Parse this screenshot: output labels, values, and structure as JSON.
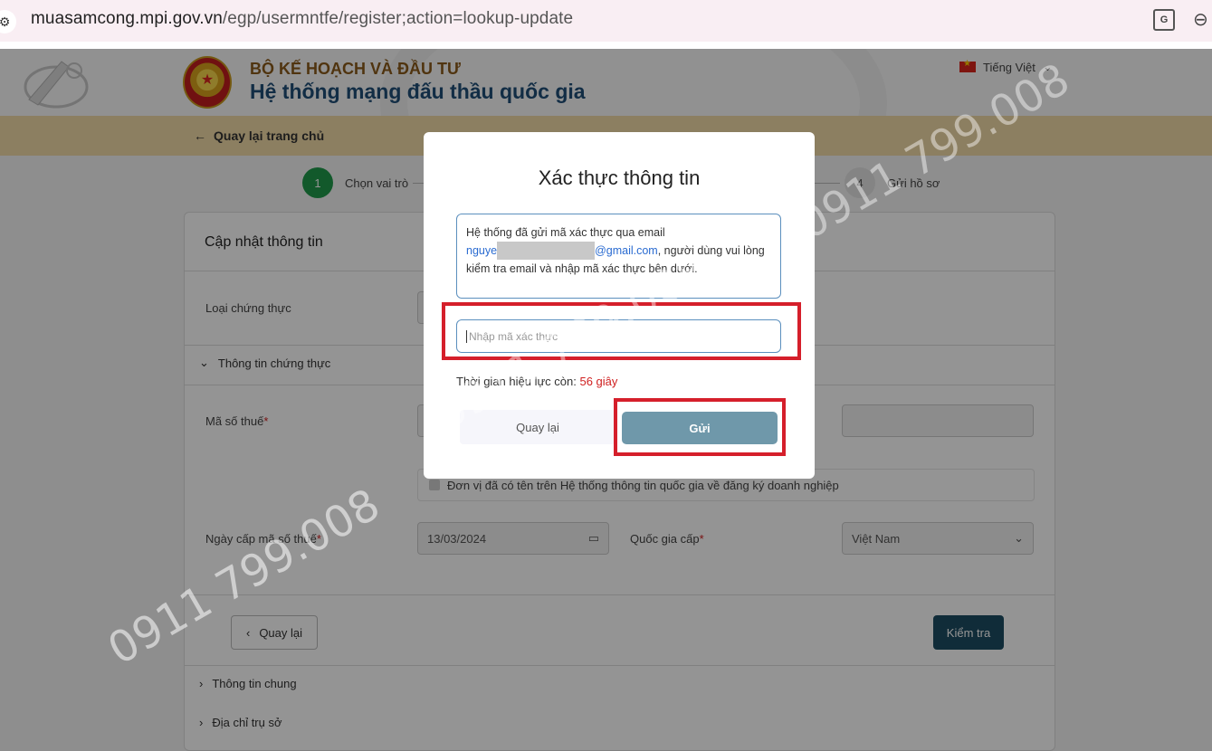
{
  "browser": {
    "url_host": "muasamcong.mpi.gov.vn",
    "url_path": "/egp/usermntfe/register;action=lookup-update"
  },
  "header": {
    "ministry": "BỘ KẾ HOẠCH VÀ ĐẦU TƯ",
    "system_title": "Hệ thống mạng đấu thầu quốc gia",
    "language": "Tiếng Việt"
  },
  "backbar": {
    "label": "Quay lại trang chủ"
  },
  "stepper": [
    {
      "number": "1",
      "label": "Chọn vai trò"
    },
    {
      "number": "4",
      "label": "Gửi hồ sơ"
    }
  ],
  "form": {
    "title": "Cập nhật thông tin",
    "cert_type_label": "Loại chứng thực",
    "cert_info_header": "Thông tin chứng thực",
    "tax_code_label": "Mã số thuế",
    "registered_checkbox": "Đơn vị đã có tên trên Hệ thống thông tin quốc gia về đăng ký doanh nghiệp",
    "tax_date_label": "Ngày cấp mã số thuế",
    "tax_date_value": "13/03/2024",
    "country_label": "Quốc gia cấp",
    "country_value": "Việt Nam",
    "back_button": "Quay lại",
    "check_button": "Kiểm tra",
    "general_info": "Thông tin chung",
    "address": "Địa chỉ trụ sở",
    "required_mark": "*"
  },
  "modal": {
    "title": "Xác thực thông tin",
    "info_prefix": "Hệ thống đã gửi mã xác thực qua email",
    "email_start": "nguye",
    "email_end": "@gmail.com",
    "info_suffix": ", người dùng vui lòng kiểm tra email và nhập mã xác thực bên dưới.",
    "code_placeholder": "Nhập mã xác thực",
    "timer_label": "Thời gian hiệu lực còn:",
    "timer_value": "56 giây",
    "cancel_button": "Quay lại",
    "send_button": "Gửi"
  },
  "watermark": "0911 799.008",
  "colors": {
    "annotation_red": "#d51f2b",
    "primary_dark": "#1c4d62",
    "send_button": "#6f98aa",
    "step_active": "#1f9a4a"
  }
}
